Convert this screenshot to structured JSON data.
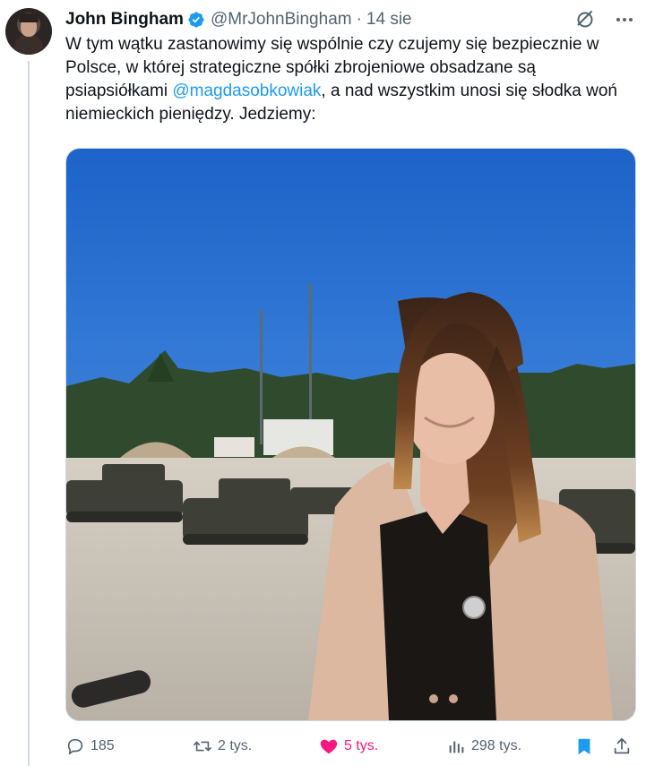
{
  "author": {
    "name": "John Bingham",
    "handle": "@MrJohnBingham",
    "separator": "·",
    "date": "14 sie",
    "verified": true
  },
  "tweet": {
    "text_before": "W tym wątku zastanowimy się wspólnie czy czujemy się bezpiecznie w Polsce, w której strategiczne spółki zbrojeniowe obsadzane są psiapsiółkami ",
    "mention": "@magdasobkowiak",
    "text_after": ", a nad wszystkim unosi się słodka woń niemieckich pieniędzy. Jedziemy:"
  },
  "metrics": {
    "replies": "185",
    "retweets": "2 tys.",
    "likes": "5 tys.",
    "views": "298 tys."
  },
  "icons": {
    "header": [
      "grok-icon",
      "more-icon"
    ],
    "actions": [
      "reply-icon",
      "retweet-icon",
      "like-icon",
      "views-icon",
      "bookmark-icon",
      "share-icon"
    ]
  },
  "colors": {
    "accent": "#1d9bf0",
    "like": "#f91880",
    "secondary_text": "#536471",
    "bookmark": "#1d9bf0"
  }
}
